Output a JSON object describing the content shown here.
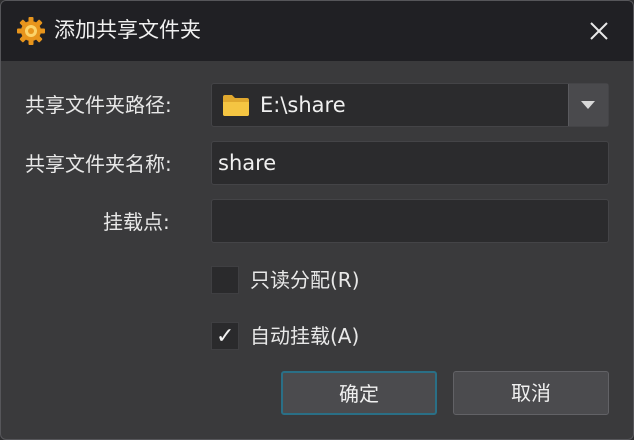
{
  "dialog": {
    "title": "添加共享文件夹",
    "icon": "gear-icon",
    "close_icon": "close-icon"
  },
  "form": {
    "path_label": "共享文件夹路径:",
    "path_value": "E:\\share",
    "name_label": "共享文件夹名称:",
    "name_value": "share",
    "mount_label": "挂载点:",
    "mount_value": ""
  },
  "options": {
    "readonly_label": "只读分配(R)",
    "readonly_checked": false,
    "automount_label": "自动挂载(A)",
    "automount_checked": true,
    "check_glyph": "✓"
  },
  "buttons": {
    "ok_label": "确定",
    "cancel_label": "取消"
  },
  "colors": {
    "titlebar": "#202024",
    "dialog_bg": "#3a3a3c",
    "field_bg": "#2b2b2d",
    "primary_border": "#2a6f86",
    "folder_yellow": "#f5c542"
  }
}
